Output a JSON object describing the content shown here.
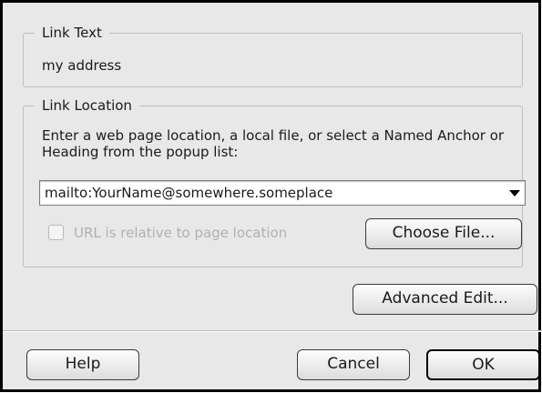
{
  "link_text_group": {
    "legend": "Link Text",
    "value": "my address"
  },
  "link_location_group": {
    "legend": "Link Location",
    "instructions": "Enter a web page location, a local file, or select a Named Anchor or Heading from the popup list:",
    "url_value": "mailto:YourName@somewhere.someplace",
    "relative_checkbox_label": "URL is relative to page location",
    "relative_checkbox_checked": false,
    "relative_checkbox_enabled": false,
    "choose_file_label": "Choose File..."
  },
  "advanced_edit_label": "Advanced Edit...",
  "footer": {
    "help_label": "Help",
    "cancel_label": "Cancel",
    "ok_label": "OK"
  }
}
